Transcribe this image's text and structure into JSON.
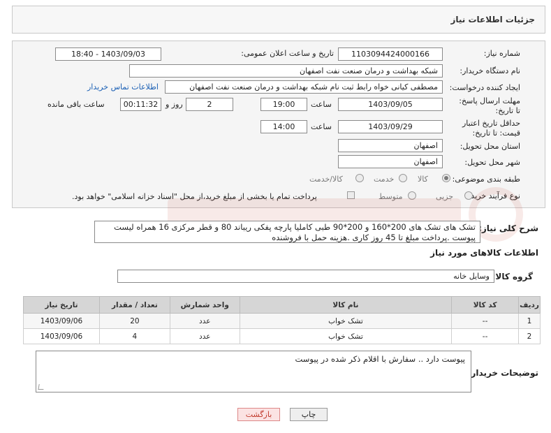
{
  "header": {
    "title": "جزئیات اطلاعات نیاز"
  },
  "form": {
    "need_number_label": "شماره نیاز:",
    "need_number": "1103094424000166",
    "announce_label": "تاریخ و ساعت اعلان عمومی:",
    "announce_value": "1403/09/03 - 18:40",
    "buyer_org_label": "نام دستگاه خریدار:",
    "buyer_org": "شبکه بهداشت و درمان صنعت نفت اصفهان",
    "creator_label": "ایجاد کننده درخواست:",
    "creator": "مصطفی کیانی خواه رابط ثبت نام شبکه بهداشت و درمان صنعت نفت اصفهان",
    "contact_link": "اطلاعات تماس خریدار",
    "deadline_label": "مهلت ارسال پاسخ: تا تاریخ:",
    "deadline_date": "1403/09/05",
    "time_word": "ساعت",
    "deadline_time": "19:00",
    "days_value": "2",
    "days_word": "روز و",
    "remaining_value": "00:11:32",
    "remaining_word": "ساعت باقی مانده",
    "validity_label": "حداقل تاریخ اعتبار قیمت: تا تاریخ:",
    "validity_date": "1403/09/29",
    "validity_time": "14:00",
    "province_label": "استان محل تحویل:",
    "province": "اصفهان",
    "city_label": "شهر محل تحویل:",
    "city": "اصفهان",
    "category_label": "طبقه بندی موضوعی:",
    "category_options": [
      "کالا",
      "خدمت",
      "کالا/خدمت"
    ],
    "process_label": "نوع فرآیند خرید :",
    "process_options": [
      "جزیی",
      "متوسط"
    ],
    "payment_note": "پرداخت تمام یا بخشی از مبلغ خرید،از محل \"اسناد خزانه اسلامی\" خواهد بود."
  },
  "description": {
    "label": "شرح کلی نیاز:",
    "text": "تشک های تشک های 200*160 و 200*90 طبی کاملیا  پارچه پفکی ریباند 80 و قطر مرکزی 16 همراه لیست پیوست .پرداخت مبلغ تا 45 روز کاری .هزینه حمل با فروشنده"
  },
  "goods": {
    "section_title": "اطلاعات کالاهای مورد نیاز",
    "group_label": "گروه کالا:",
    "group_value": "وسایل خانه",
    "columns": [
      "ردیف",
      "کد کالا",
      "نام کالا",
      "واحد شمارش",
      "تعداد / مقدار",
      "تاریخ نیاز"
    ],
    "rows": [
      [
        "1",
        "--",
        "تشک خواب",
        "عدد",
        "20",
        "1403/09/06"
      ],
      [
        "2",
        "--",
        "تشک خواب",
        "عدد",
        "4",
        "1403/09/06"
      ]
    ]
  },
  "buyer_notes": {
    "label": "توضیحات خریدار:",
    "text": "پیوست دارد ..  سفارش با اقلام ذکر شده در پیوست"
  },
  "buttons": {
    "print": "چاپ",
    "back": "بازگشت"
  }
}
